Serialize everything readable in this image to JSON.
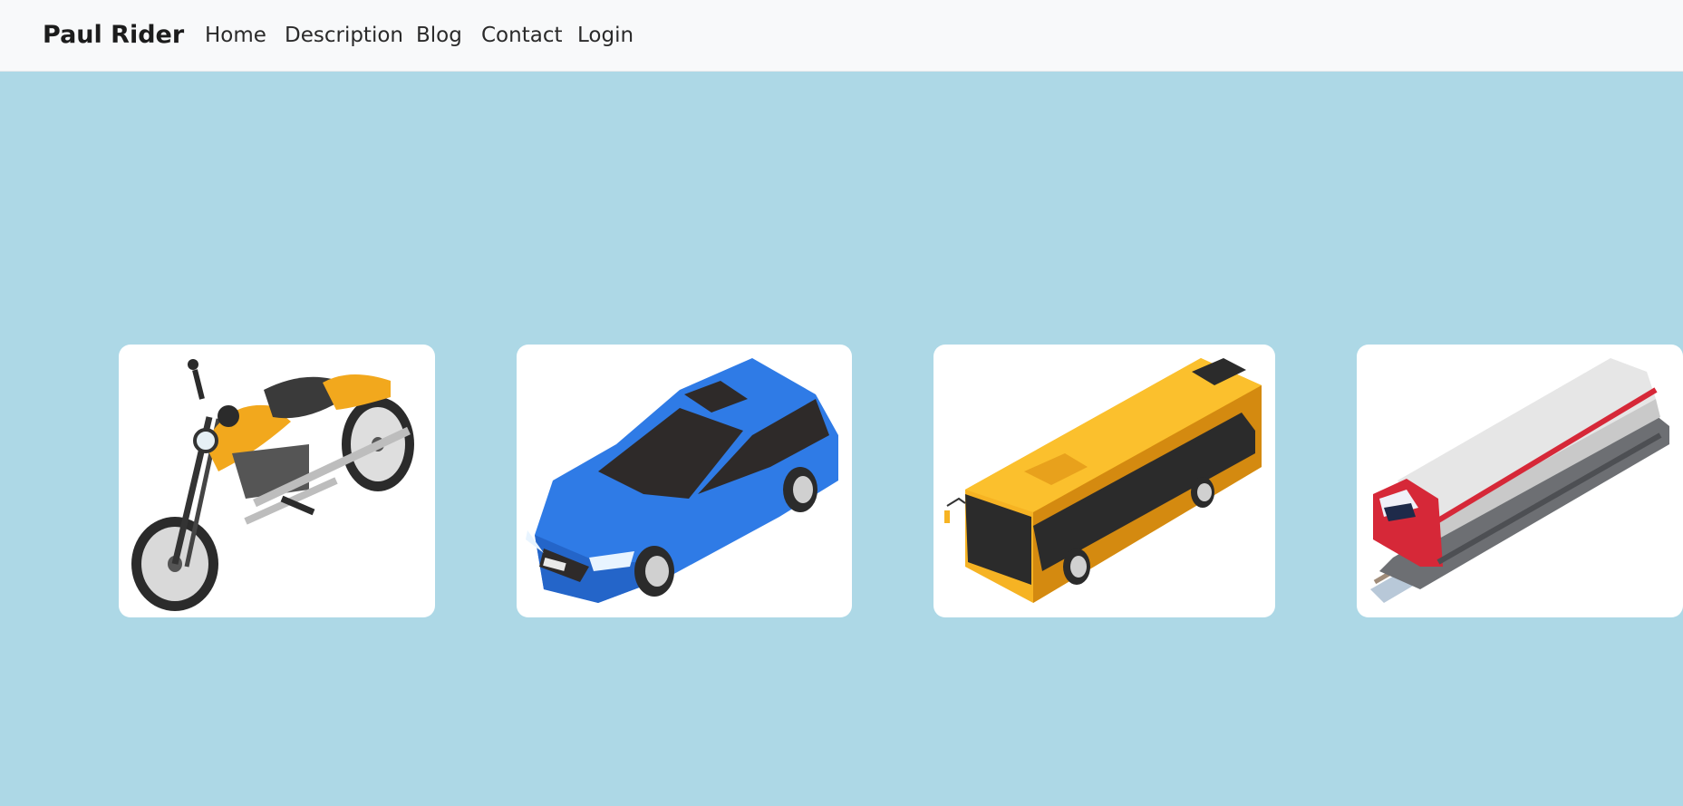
{
  "navbar": {
    "brand": "Paul Rider",
    "links": [
      {
        "label": "Home"
      },
      {
        "label": "Description"
      },
      {
        "label": "Blog"
      },
      {
        "label": "Contact"
      },
      {
        "label": "Login"
      }
    ]
  },
  "gallery": {
    "items": [
      {
        "icon": "motorcycle-image"
      },
      {
        "icon": "car-image"
      },
      {
        "icon": "bus-image"
      },
      {
        "icon": "train-image"
      }
    ]
  },
  "colors": {
    "page_background": "#add8e6",
    "navbar_background": "#f8f9fa",
    "card_background": "#ffffff"
  }
}
